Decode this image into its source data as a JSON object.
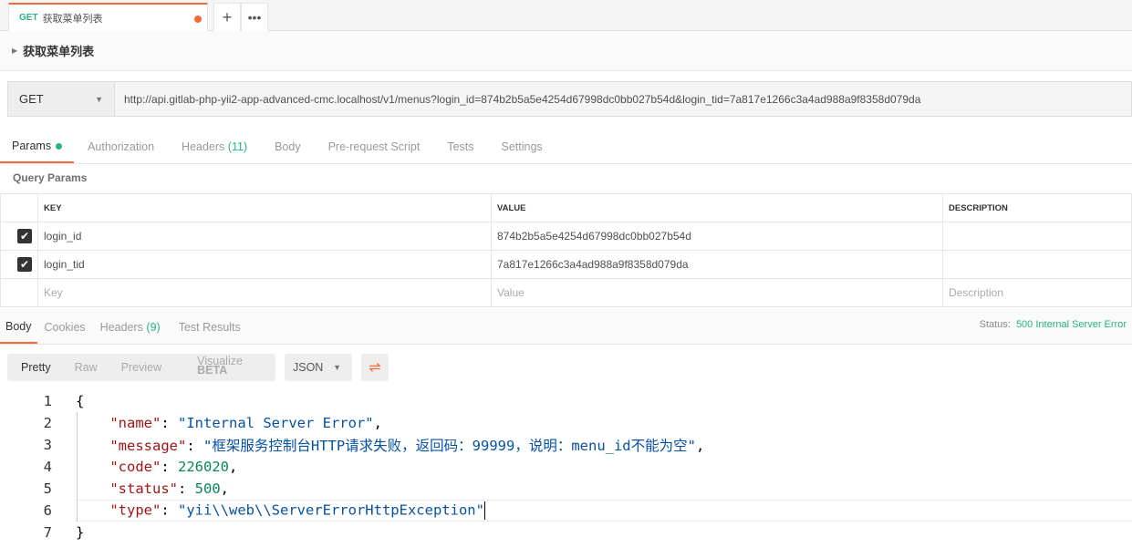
{
  "tab": {
    "method": "GET",
    "name": "获取菜单列表"
  },
  "title": "获取菜单列表",
  "request": {
    "method": "GET",
    "url": "http://api.gitlab-php-yii2-app-advanced-cmc.localhost/v1/menus?login_id=874b2b5a5e4254d67998dc0bb027b54d&login_tid=7a817e1266c3a4ad988a9f8358d079da"
  },
  "req_tabs": {
    "params": "Params",
    "authorization": "Authorization",
    "headers": "Headers",
    "headers_count": "(11)",
    "body": "Body",
    "prerequest": "Pre-request Script",
    "tests": "Tests",
    "settings": "Settings"
  },
  "query_params_label": "Query Params",
  "table": {
    "headers": [
      "KEY",
      "VALUE",
      "DESCRIPTION"
    ],
    "rows": [
      {
        "key": "login_id",
        "value": "874b2b5a5e4254d67998dc0bb027b54d",
        "description": ""
      },
      {
        "key": "login_tid",
        "value": "7a817e1266c3a4ad988a9f8358d079da",
        "description": ""
      }
    ],
    "placeholders": {
      "key": "Key",
      "value": "Value",
      "description": "Description"
    }
  },
  "res_tabs": {
    "body": "Body",
    "cookies": "Cookies",
    "headers": "Headers",
    "headers_count": "(9)",
    "tests": "Test Results"
  },
  "status": {
    "label": "Status:",
    "value": "500 Internal Server Error"
  },
  "view": {
    "pretty": "Pretty",
    "raw": "Raw",
    "preview": "Preview",
    "visualize": "Visualize",
    "beta": "BETA",
    "format": "JSON"
  },
  "code": {
    "l1": "{",
    "name_k": "\"name\"",
    "name_v": "\"Internal Server Error\"",
    "message_k": "\"message\"",
    "message_v": "\"框架服务控制台HTTP请求失败，返回码：99999，说明：menu_id不能为空\"",
    "code_k": "\"code\"",
    "code_v": "226020",
    "status_k": "\"status\"",
    "status_v": "500",
    "type_k": "\"type\"",
    "type_v": "\"yii\\\\web\\\\ServerErrorHttpException\"",
    "l7": "}"
  }
}
